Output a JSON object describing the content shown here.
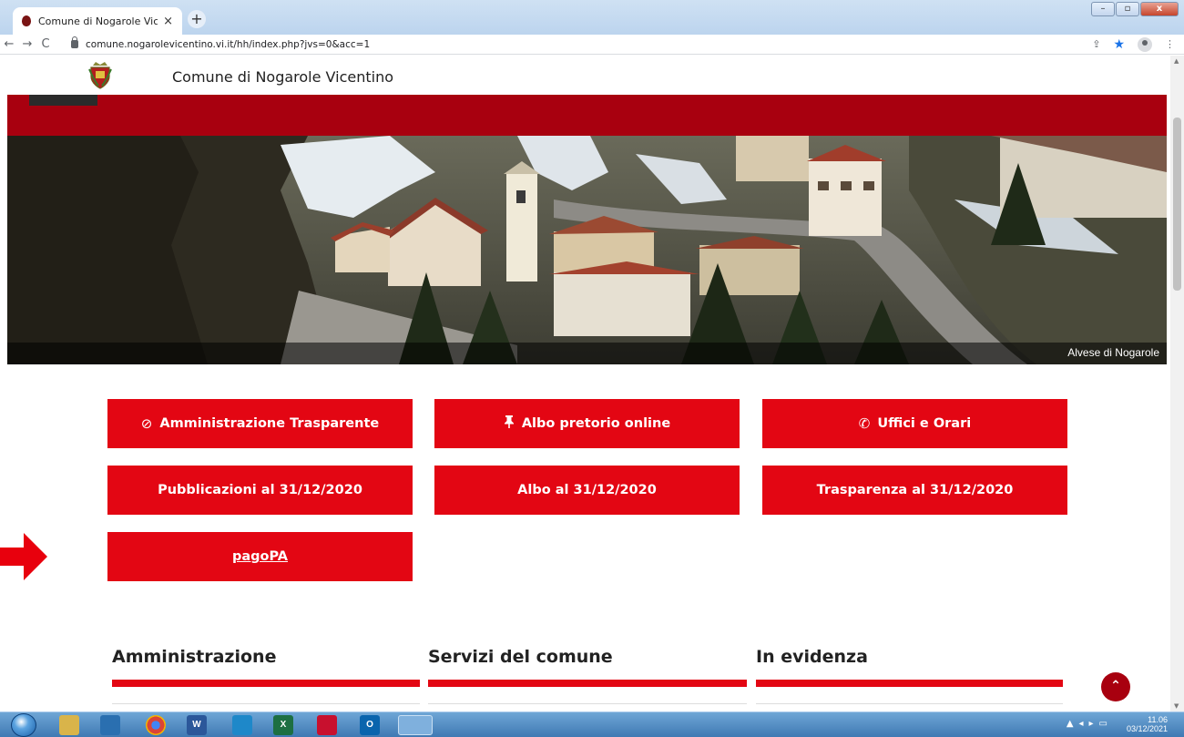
{
  "browser": {
    "tab_title": "Comune di Nogarole Vicentino",
    "tab_close": "×",
    "new_tab": "+",
    "url": "comune.nogarolevicentino.vi.it/hh/index.php?jvs=0&acc=1",
    "back": "←",
    "forward": "→",
    "reload": "C",
    "share": "⇪",
    "star": "★",
    "menu": "⋮",
    "min": "–",
    "max": "▫",
    "close": "x"
  },
  "site": {
    "name": "Comune di Nogarole Vicentino",
    "hero_caption": "Alvese di Nogarole"
  },
  "quick_links": {
    "row1": [
      {
        "label": "Amministrazione Trasparente",
        "icon": "⊘"
      },
      {
        "label": "Albo pretorio online",
        "icon": "📌"
      },
      {
        "label": "Uffici e Orari",
        "icon": "✆"
      }
    ],
    "row2": [
      {
        "label": "Pubblicazioni al 31/12/2020"
      },
      {
        "label": "Albo al 31/12/2020"
      },
      {
        "label": "Trasparenza al 31/12/2020"
      }
    ],
    "pagopa": {
      "label": "pagoPA"
    }
  },
  "sections": [
    {
      "title": "Amministrazione"
    },
    {
      "title": "Servizi del comune"
    },
    {
      "title": "In evidenza"
    }
  ],
  "back_to_top": "⌃",
  "taskbar": {
    "time": "11.06",
    "date": "03/12/2021",
    "apps": [
      "explorer-icon",
      "outlook-express-icon",
      "chrome-icon",
      "word-icon",
      "ie-icon",
      "excel-icon",
      "acrobat-icon",
      "outlook-icon",
      "ie-active-icon"
    ],
    "word": "W",
    "excel": "X",
    "outlook": "O"
  },
  "colors": {
    "primary_red": "#e30613",
    "dark_red": "#a8000f",
    "arrow_red": "#e8000d"
  }
}
